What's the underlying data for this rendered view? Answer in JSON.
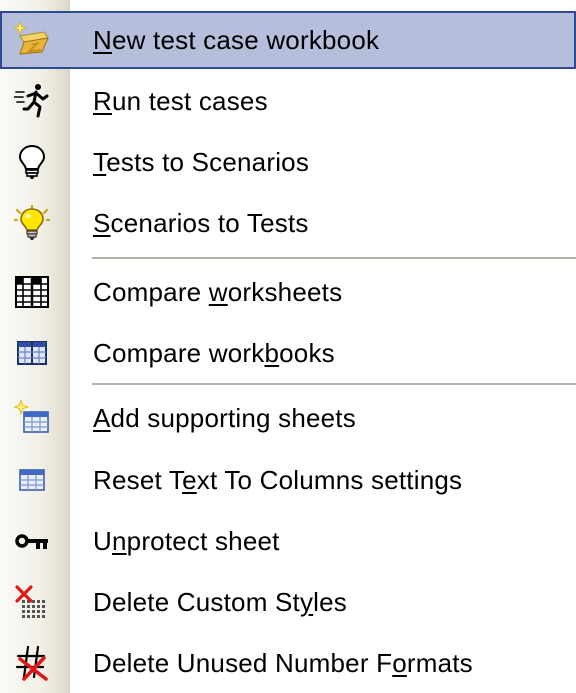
{
  "menu": {
    "items": [
      {
        "pre": "",
        "key": "N",
        "post": "ew test case workbook",
        "icon": "new-workbook-icon",
        "selected": true
      },
      {
        "pre": "",
        "key": "R",
        "post": "un test cases",
        "icon": "running-man-icon"
      },
      {
        "pre": "",
        "key": "T",
        "post": "ests to Scenarios",
        "icon": "lightbulb-off-icon"
      },
      {
        "pre": "",
        "key": "S",
        "post": "cenarios to Tests",
        "icon": "lightbulb-on-icon"
      },
      {
        "pre": "Compare ",
        "key": "w",
        "post": "orksheets",
        "icon": "compare-worksheets-icon"
      },
      {
        "pre": "Compare work",
        "key": "b",
        "post": "ooks",
        "icon": "compare-workbooks-icon"
      },
      {
        "pre": "",
        "key": "A",
        "post": "dd supporting sheets",
        "icon": "add-sheets-icon"
      },
      {
        "pre": "Reset T",
        "key": "e",
        "post": "xt To Columns settings",
        "icon": "table-icon"
      },
      {
        "pre": "U",
        "key": "n",
        "post": "protect sheet",
        "icon": "key-icon"
      },
      {
        "pre": "Delete Custom St",
        "key": "y",
        "post": "les",
        "icon": "delete-styles-icon"
      },
      {
        "pre": "Delete Unused Number F",
        "key": "o",
        "post": "rmats",
        "icon": "delete-formats-icon"
      }
    ]
  },
  "colors": {
    "highlight": "#b5bfdc",
    "highlight_border": "#2f4a92",
    "separator": "#b4b2a8"
  }
}
